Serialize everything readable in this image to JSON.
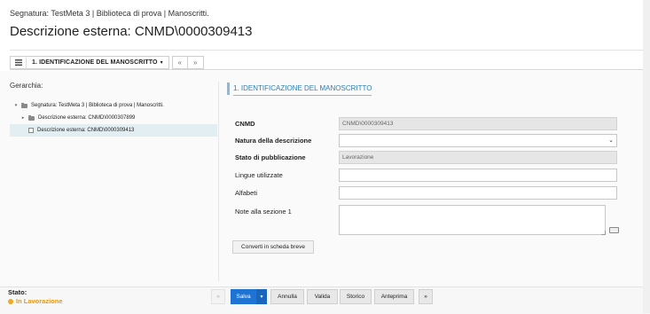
{
  "header": {
    "breadcrumb": "Segnatura: TestMeta 3 | Biblioteca di prova | Manoscritti.",
    "title": "Descrizione esterna: CNMD\\0000309413"
  },
  "tabs": {
    "section_label": "1. IDENTIFICAZIONE DEL MANOSCRITTO",
    "prev": "«",
    "next": "»"
  },
  "hierarchy": {
    "label": "Gerarchia:",
    "items": [
      {
        "label": "Segnatura: TestMeta 3 | Biblioteca di prova | Manoscritti."
      },
      {
        "label": "Descrizione esterna: CNMD\\0000307899"
      },
      {
        "label": "Descrizione esterna: CNMD\\0000309413"
      }
    ]
  },
  "form": {
    "section_title": "1. IDENTIFICAZIONE DEL MANOSCRITTO",
    "fields": [
      {
        "label": "CNMD",
        "value": "CNMD\\0000309413"
      },
      {
        "label": "Natura della descrizione",
        "value": ""
      },
      {
        "label": "Stato di pubblicazione",
        "value": "Lavorazione"
      },
      {
        "label": "Lingue utilizzate",
        "value": ""
      },
      {
        "label": "Alfabeti",
        "value": ""
      },
      {
        "label": "Note alla sezione 1",
        "value": ""
      }
    ],
    "convert_button": "Converti in scheda breve"
  },
  "footer": {
    "status_label": "Stato:",
    "status_value": "In Lavorazione",
    "status_color": "#f0a820",
    "buttons": {
      "prev": "«",
      "save": "Salva",
      "save_dropdown": "▾",
      "cancel": "Annulla",
      "validate": "Valida",
      "history": "Storico",
      "preview": "Anteprima",
      "next": "»"
    }
  },
  "icons": {
    "list": "list-icon",
    "folder": "folder-icon",
    "document": "document-icon",
    "chevron": "chevron-down-icon",
    "keyboard": "keyboard-icon"
  },
  "colors": {
    "accent": "#2f7fb2",
    "primary_button": "#1f73d2",
    "selected_row": "#e3eef3"
  }
}
